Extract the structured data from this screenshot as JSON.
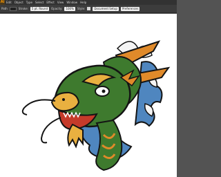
{
  "menubar": {
    "logo": "Ai",
    "items": [
      "Edit",
      "Object",
      "Type",
      "Select",
      "Effect",
      "View",
      "Window",
      "Help"
    ]
  },
  "options": {
    "mode_label": "Path",
    "stroke_label": "Stroke:",
    "brush_label": "5 pt. Round",
    "opacity_label": "Opacity:",
    "opacity_value": "100%",
    "style_label": "Style:",
    "document_setup": "Document Setup",
    "preferences": "Preferences"
  },
  "canvas": {
    "image": "dragon-head-illustration",
    "colors": {
      "green": "#3e7a2e",
      "orange": "#e08a2a",
      "blue": "#4f86bf",
      "outline": "#141414"
    }
  }
}
